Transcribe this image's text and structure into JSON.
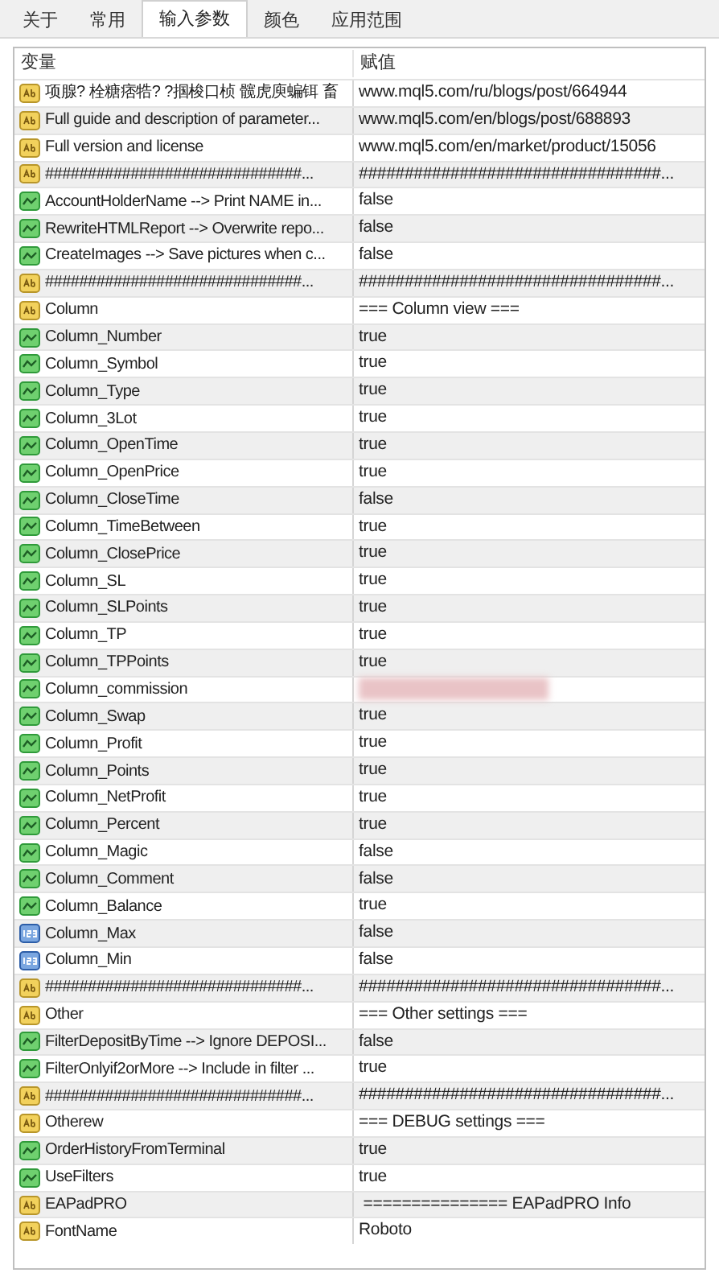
{
  "tabs": [
    {
      "label": "关于",
      "selected": false
    },
    {
      "label": "常用",
      "selected": false
    },
    {
      "label": "输入参数",
      "selected": true
    },
    {
      "label": "颜色",
      "selected": false
    },
    {
      "label": "应用范围",
      "selected": false
    }
  ],
  "table": {
    "columns": [
      "变量",
      "赋值"
    ],
    "rows": [
      {
        "kind": "string",
        "name": "项腺? 栓糖痞牿? ?掴梭口桢 髋虎庾蝙铒 畜",
        "value": "www.mql5.com/ru/blogs/post/664944"
      },
      {
        "kind": "string",
        "name": "Full guide and description of parameter...",
        "value": "www.mql5.com/en/blogs/post/688893"
      },
      {
        "kind": "string",
        "name": "Full version and license",
        "value": "www.mql5.com/en/market/product/15056"
      },
      {
        "kind": "string",
        "name": "##############################...",
        "value": "#################################..."
      },
      {
        "kind": "bool",
        "name": "AccountHolderName --> Print NAME in...",
        "value": "false"
      },
      {
        "kind": "bool",
        "name": "RewriteHTMLReport --> Overwrite repo...",
        "value": "false"
      },
      {
        "kind": "bool",
        "name": "CreateImages --> Save pictures when c...",
        "value": "false"
      },
      {
        "kind": "string",
        "name": "##############################...",
        "value": "#################################..."
      },
      {
        "kind": "string",
        "name": "Column",
        "value": "=== Column view ==="
      },
      {
        "kind": "bool",
        "name": "Column_Number",
        "value": "true"
      },
      {
        "kind": "bool",
        "name": "Column_Symbol",
        "value": "true"
      },
      {
        "kind": "bool",
        "name": "Column_Type",
        "value": "true"
      },
      {
        "kind": "bool",
        "name": "Column_3Lot",
        "value": "true"
      },
      {
        "kind": "bool",
        "name": "Column_OpenTime",
        "value": "true"
      },
      {
        "kind": "bool",
        "name": "Column_OpenPrice",
        "value": "true"
      },
      {
        "kind": "bool",
        "name": "Column_CloseTime",
        "value": "false"
      },
      {
        "kind": "bool",
        "name": "Column_TimeBetween",
        "value": "true"
      },
      {
        "kind": "bool",
        "name": "Column_ClosePrice",
        "value": "true"
      },
      {
        "kind": "bool",
        "name": "Column_SL",
        "value": "true"
      },
      {
        "kind": "bool",
        "name": "Column_SLPoints",
        "value": "true"
      },
      {
        "kind": "bool",
        "name": "Column_TP",
        "value": "true"
      },
      {
        "kind": "bool",
        "name": "Column_TPPoints",
        "value": "true"
      },
      {
        "kind": "bool",
        "name": "Column_commission",
        "redacted": true
      },
      {
        "kind": "bool",
        "name": "Column_Swap",
        "value": "true"
      },
      {
        "kind": "bool",
        "name": "Column_Profit",
        "value": "true"
      },
      {
        "kind": "bool",
        "name": "Column_Points",
        "value": "true"
      },
      {
        "kind": "bool",
        "name": "Column_NetProfit",
        "value": "true"
      },
      {
        "kind": "bool",
        "name": "Column_Percent",
        "value": "true"
      },
      {
        "kind": "bool",
        "name": "Column_Magic",
        "value": "false"
      },
      {
        "kind": "bool",
        "name": "Column_Comment",
        "value": "false"
      },
      {
        "kind": "bool",
        "name": "Column_Balance",
        "value": "true"
      },
      {
        "kind": "number",
        "name": "Column_Max",
        "value": "false"
      },
      {
        "kind": "number",
        "name": "Column_Min",
        "value": "false"
      },
      {
        "kind": "string",
        "name": "##############################...",
        "value": "#################################..."
      },
      {
        "kind": "string",
        "name": "Other",
        "value": "=== Other settings ==="
      },
      {
        "kind": "bool",
        "name": "FilterDepositByTime --> Ignore DEPOSI...",
        "value": "false"
      },
      {
        "kind": "bool",
        "name": "FilterOnlyif2orMore --> Include in filter ...",
        "value": "true"
      },
      {
        "kind": "string",
        "name": "##############################...",
        "value": "#################################..."
      },
      {
        "kind": "string",
        "name": "Otherew",
        "value": "=== DEBUG settings ==="
      },
      {
        "kind": "bool",
        "name": "OrderHistoryFromTerminal",
        "value": "true"
      },
      {
        "kind": "bool",
        "name": "UseFilters",
        "value": "true"
      },
      {
        "kind": "string",
        "name": "EAPadPRO",
        "value": " =============== EAPadPRO Info"
      },
      {
        "kind": "string",
        "name": "FontName",
        "value": "Roboto"
      }
    ]
  }
}
